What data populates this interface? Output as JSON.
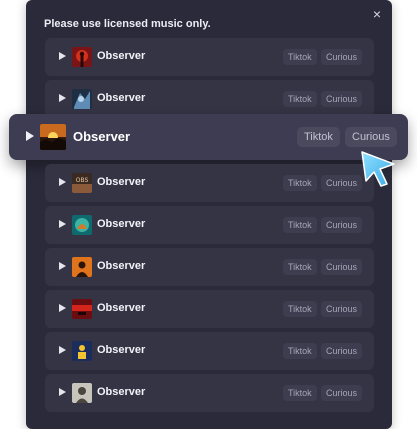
{
  "dialog": {
    "notice": "Please use licensed music only.",
    "close_label": "×"
  },
  "tracks": [
    {
      "title": "Observer",
      "tags": [
        "Tiktok",
        "Curious"
      ]
    },
    {
      "title": "Observer",
      "tags": [
        "Tiktok",
        "Curious"
      ]
    },
    {
      "title": "Observer",
      "tags": [
        "Tiktok",
        "Curious"
      ],
      "highlighted": true
    },
    {
      "title": "Observer",
      "tags": [
        "Tiktok",
        "Curious"
      ]
    },
    {
      "title": "Observer",
      "tags": [
        "Tiktok",
        "Curious"
      ]
    },
    {
      "title": "Observer",
      "tags": [
        "Tiktok",
        "Curious"
      ]
    },
    {
      "title": "Observer",
      "tags": [
        "Tiktok",
        "Curious"
      ]
    },
    {
      "title": "Observer",
      "tags": [
        "Tiktok",
        "Curious"
      ]
    },
    {
      "title": "Observer",
      "tags": [
        "Tiktok",
        "Curious"
      ]
    }
  ],
  "colors": {
    "panel": "#2b2a3a",
    "row": "#353445",
    "highlight_row": "#3d3c52",
    "cursor": "#5ec8f2"
  }
}
